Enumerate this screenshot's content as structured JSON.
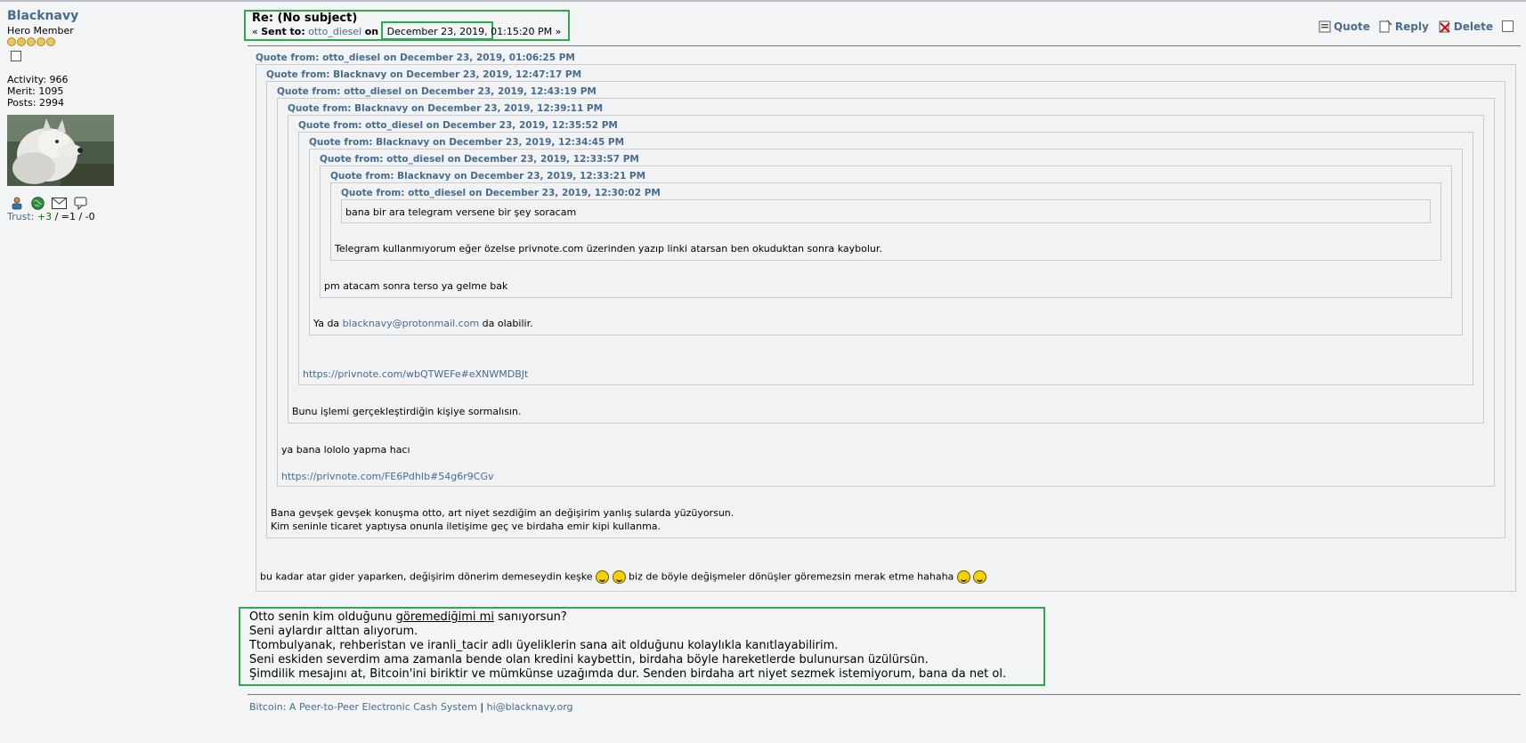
{
  "poster": {
    "name": "Blacknavy",
    "rank": "Hero Member",
    "stars": 5,
    "activity": "Activity: 966",
    "merit": "Merit: 1095",
    "posts": "Posts: 2994",
    "trust_label": "Trust:",
    "trust_pos": "+3",
    "trust_sep1": " / ",
    "trust_neutral": "=1",
    "trust_sep2": " / ",
    "trust_neg": "-0",
    "icons": [
      "user-profile-icon",
      "website-globe-icon",
      "email-envelope-icon",
      "personal-message-icon"
    ]
  },
  "post": {
    "subject": "Re: (No subject)",
    "sent_prefix": "« ",
    "sent_to_label": "Sent to:",
    "sent_to_user": "otto_diesel",
    "on_label": "on",
    "date": "December 23, 2019,",
    "time": "01:15:20 PM",
    "sent_suffix": " »"
  },
  "actions": {
    "quote": "Quote",
    "reply": "Reply",
    "delete": "Delete"
  },
  "quotes": {
    "h1": "Quote from: otto_diesel on December 23, 2019, 01:06:25 PM",
    "h2": "Quote from: Blacknavy on December 23, 2019, 12:47:17 PM",
    "h3": "Quote from: otto_diesel on December 23, 2019, 12:43:19 PM",
    "h4": "Quote from: Blacknavy on December 23, 2019, 12:39:11 PM",
    "h5": "Quote from: otto_diesel on December 23, 2019, 12:35:52 PM",
    "h6": "Quote from: Blacknavy on December 23, 2019, 12:34:45 PM",
    "h7": "Quote from: otto_diesel on December 23, 2019, 12:33:57 PM",
    "h8": "Quote from: Blacknavy on December 23, 2019, 12:33:21 PM",
    "h9": "Quote from: otto_diesel on December 23, 2019, 12:30:02 PM",
    "t9": "bana bir ara telegram versene bir şey soracam",
    "t8": "Telegram kullanmıyorum eğer özelse privnote.com üzerinden yazıp linki atarsan ben okuduktan sonra kaybolur.",
    "t7": "pm atacam sonra terso ya gelme bak",
    "t6_pre": "Ya da ",
    "t6_link": "blacknavy@protonmail.com",
    "t6_post": " da olabilir.",
    "t5_link": "https://privnote.com/wbQTWEFe#eXNWMDBJt",
    "t4": "Bunu işlemi gerçekleştirdiğin kişiye sormalısın.",
    "t3": "ya bana lololo yapma hacı",
    "t3_link": "https://privnote.com/FE6PdhIb#54g6r9CGv",
    "t2_line1": "Bana gevşek gevşek konuşma otto, art niyet sezdiğim an değişirim yanlış sularda yüzüyorsun.",
    "t2_line2": "Kim seninle ticaret yaptıysa onunla iletişime geç ve birdaha emir kipi kullanma.",
    "t1_pre": "bu kadar atar gider yaparken, değişirim dönerim demeseydin keşke",
    "t1_mid": "biz de böyle değişmeler dönüşler göremezsin merak etme hahaha"
  },
  "message": {
    "l1_pre": "Otto senin kim olduğunu ",
    "l1_ul": "göremediğimi mi",
    "l1_post": " sanıyorsun?",
    "l2": "Seni aylardır alttan alıyorum.",
    "l3": "Ttombulyanak, rehberistan ve iranli_tacir adlı üyeliklerin sana ait olduğunu kolaylıkla kanıtlayabilirim.",
    "l4": "Seni eskiden severdim ama zamanla bende olan kredini kaybettin, birdaha böyle hareketlerde bulunursan üzülürsün.",
    "l5": "Şimdilik mesajını at, Bitcoin'ini biriktir ve mümkünse uzağımda dur. Senden birdaha art niyet sezmek istemiyorum, bana da net ol."
  },
  "footer": {
    "link1": "Bitcoin: A Peer-to-Peer Electronic Cash System",
    "sep": " | ",
    "link2": "hi@blacknavy.org"
  },
  "colors": {
    "link": "#476c8e",
    "highlight": "#2fa84f",
    "quote_border": "#cacbcf",
    "background": "#f3f4f5"
  }
}
